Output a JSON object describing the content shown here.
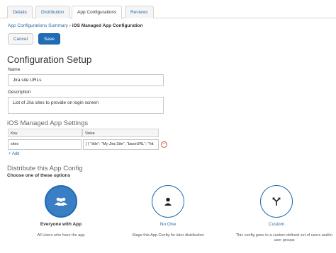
{
  "tabs": [
    {
      "label": "Details",
      "active": false
    },
    {
      "label": "Distribution",
      "active": false
    },
    {
      "label": "App Configurations",
      "active": true
    },
    {
      "label": "Reviews",
      "active": false
    }
  ],
  "breadcrumb": {
    "link": "App Configurations Summary",
    "separator": "›",
    "current": "iOS Managed App Configuration"
  },
  "actions": {
    "cancel": "Cancel",
    "save": "Save"
  },
  "config": {
    "title": "Configuration Setup",
    "name_label": "Name",
    "name_value": "Jira site URLs",
    "description_label": "Description",
    "description_value": "List of Jira sites to provide on login screen"
  },
  "settings": {
    "title": "iOS Managed App Settings",
    "columns": {
      "key": "Key",
      "value": "Value"
    },
    "row": {
      "key": "sites",
      "value": "[ { \"title\": \"My Jira Site\", \"baseURL\": \"htt"
    },
    "add_label": "+ Add"
  },
  "distribute": {
    "title": "Distribute this App Config",
    "subtitle": "Choose one of these options",
    "options": [
      {
        "title": "Everyone with App",
        "description": "All Users who have the app",
        "selected": true,
        "icon": "group-icon"
      },
      {
        "title": "No One",
        "description": "Stage this App Config for later distribution",
        "selected": false,
        "icon": "user-icon"
      },
      {
        "title": "Custom",
        "description": "This config goes to a custom defined set of users and/or user groups",
        "selected": false,
        "icon": "fork-arrow-icon"
      }
    ]
  },
  "colors": {
    "accent": "#1f6db6",
    "link": "#2e6ca4",
    "danger": "#d9534f"
  }
}
